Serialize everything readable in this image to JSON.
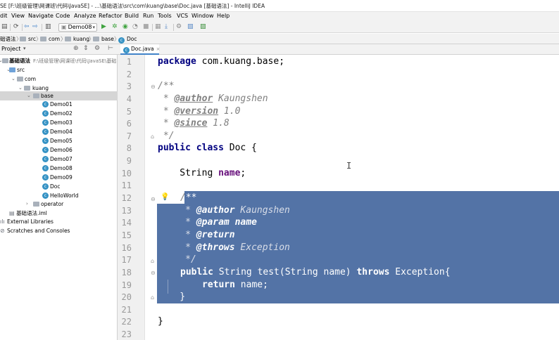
{
  "window": {
    "title": "SE [F:\\班级管理\\网课班\\代码\\JavaSE] - ...\\基础语法\\src\\com\\kuang\\base\\Doc.java [基础语法] - IntelliJ IDEA"
  },
  "menu": [
    "dit",
    "View",
    "Navigate",
    "Code",
    "Analyze",
    "Refactor",
    "Build",
    "Run",
    "Tools",
    "VCS",
    "Window",
    "Help"
  ],
  "toolbar": {
    "run_config": "Demo08"
  },
  "breadcrumb": [
    "础语法",
    "src",
    "com",
    "kuang",
    "base",
    "Doc"
  ],
  "project": {
    "header": "Project",
    "root": "基础语法",
    "root_path": "F:\\班级管理\\网课班\\代码\\JavaSE\\基础",
    "items": [
      "src",
      "com",
      "kuang",
      "base",
      "Demo01",
      "Demo02",
      "Demo03",
      "Demo04",
      "Demo05",
      "Demo06",
      "Demo07",
      "Demo08",
      "Demo09",
      "Doc",
      "HelloWorld",
      "operator",
      "基础语法.iml",
      "External Libraries",
      "Scratches and Consoles"
    ]
  },
  "editor": {
    "tab": "Doc.java",
    "line_numbers": [
      "1",
      "2",
      "3",
      "4",
      "5",
      "6",
      "7",
      "8",
      "9",
      "10",
      "11",
      "12",
      "13",
      "14",
      "15",
      "16",
      "17",
      "18",
      "19",
      "20",
      "21",
      "22",
      "23"
    ],
    "code": {
      "l1_kw": "package",
      "l1_rest": " com.kuang.base;",
      "l3": "/**",
      "l4_star": " * ",
      "l4_tag": "@author",
      "l4_val": " Kaungshen",
      "l5_star": " * ",
      "l5_tag": "@version",
      "l5_val": " 1.0",
      "l6_star": " * ",
      "l6_tag": "@since",
      "l6_val": " 1.8",
      "l7": " */",
      "l8_kw": "public class",
      "l8_rest": " Doc {",
      "l10_type": "    String ",
      "l10_field": "name",
      "l10_end": ";",
      "l12_slash": "/",
      "l12_stars": "**",
      "l13_star": "     * ",
      "l13_tag": "@author",
      "l13_val": " Kaungshen",
      "l14_star": "     * ",
      "l14_tag": "@param",
      "l14_val": " name",
      "l15_star": "     * ",
      "l15_tag": "@return",
      "l16_star": "     * ",
      "l16_tag": "@throws",
      "l16_val": " Exception",
      "l17": "     */",
      "l18_kw1": "public",
      "l18_mid": " String test(String name) ",
      "l18_kw2": "throws",
      "l18_end": " Exception{",
      "l19_kw": "return",
      "l19_rest": " name;",
      "l20": "    }",
      "l22": "}"
    }
  },
  "colors": {
    "selection": "#5373a6",
    "keyword": "#000080",
    "doc_comment": "#808080",
    "field": "#660e7a",
    "class_icon": "#3592c4"
  }
}
